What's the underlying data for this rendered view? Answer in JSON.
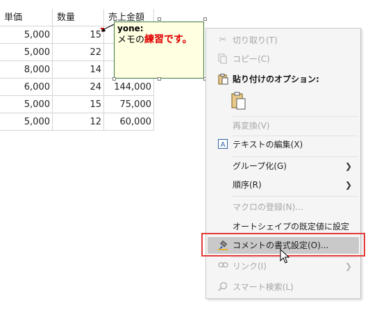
{
  "spreadsheet": {
    "headers": [
      "単価",
      "数量",
      "売上金額"
    ],
    "rows": [
      {
        "unit_price": "5,000",
        "qty": "15",
        "sales": ""
      },
      {
        "unit_price": "5,000",
        "qty": "22",
        "sales": ""
      },
      {
        "unit_price": "8,000",
        "qty": "14",
        "sales": ""
      },
      {
        "unit_price": "6,000",
        "qty": "24",
        "sales": "144,000"
      },
      {
        "unit_price": "5,000",
        "qty": "15",
        "sales": "75,000"
      },
      {
        "unit_price": "5,000",
        "qty": "12",
        "sales": "60,000"
      }
    ]
  },
  "comment": {
    "author": "yone:",
    "text_prefix": "メモの",
    "text_highlight": "練習です。",
    "highlight_color": "#e00000",
    "background": "#ffffe1"
  },
  "context_menu": {
    "items": {
      "cut": {
        "label": "切り取り(T)",
        "icon": "scissors-icon",
        "enabled": false
      },
      "copy": {
        "label": "コピー(C)",
        "icon": "copy-icon",
        "enabled": false
      },
      "paste_options": {
        "label": "貼り付けのオプション:",
        "icon": "clipboard-icon"
      },
      "reconvert": {
        "label": "再変換(V)",
        "enabled": false
      },
      "edit_text": {
        "label": "テキストの編集(X)",
        "icon": "text-box-icon",
        "enabled": true
      },
      "group": {
        "label": "グループ化(G)",
        "enabled": true,
        "has_submenu": true
      },
      "order": {
        "label": "順序(R)",
        "enabled": true,
        "has_submenu": true
      },
      "assign_macro": {
        "label": "マクロの登録(N)...",
        "enabled": false
      },
      "set_default_shape": {
        "label": "オートシェイプの既定値に設定(D)",
        "enabled": true
      },
      "format_comment": {
        "label": "コメントの書式設定(O)...",
        "icon": "format-brush-icon",
        "enabled": true,
        "highlighted": true
      },
      "link": {
        "label": "リンク(I)",
        "icon": "link-icon",
        "enabled": false,
        "has_submenu": true
      },
      "smart_lookup": {
        "label": "スマート検索(L)",
        "icon": "search-icon",
        "enabled": false
      }
    }
  },
  "colors": {
    "menu_background": "#f5f5f5",
    "menu_hover": "#c9c9c9",
    "callout_border": "#e53838",
    "comment_border": "#3c7a3c"
  }
}
